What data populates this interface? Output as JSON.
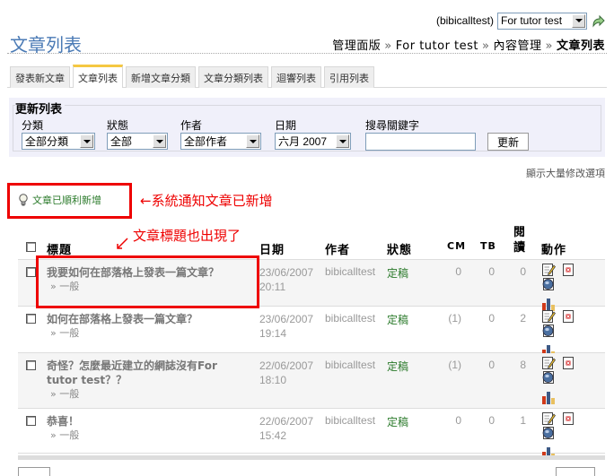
{
  "topbar": {
    "user": "(bibicalltest)",
    "blog_select": "For tutor test"
  },
  "page": {
    "title": "文章列表"
  },
  "breadcrumb": [
    "管理面版",
    "For tutor test",
    "內容管理",
    "文章列表"
  ],
  "breadcrumb_separator": "»",
  "tabs": [
    {
      "label": "發表新文章",
      "active": false
    },
    {
      "label": "文章列表",
      "active": true
    },
    {
      "label": "新增文章分類",
      "active": false
    },
    {
      "label": "文章分類列表",
      "active": false
    },
    {
      "label": "迴響列表",
      "active": false
    },
    {
      "label": "引用列表",
      "active": false
    }
  ],
  "filter": {
    "legend": "更新列表",
    "category": {
      "label": "分類",
      "value": "全部分類"
    },
    "status": {
      "label": "狀態",
      "value": "全部"
    },
    "author": {
      "label": "作者",
      "value": "全部作者"
    },
    "date": {
      "label": "日期",
      "value": "六月 2007"
    },
    "keyword": {
      "label": "搜尋關鍵字",
      "value": ""
    },
    "update_button": "更新"
  },
  "bulk_edit_link": "顯示大量修改選項",
  "notice": {
    "text": "文章已順利新增",
    "icon": "lightbulb-icon"
  },
  "annotations": {
    "notice": "←系統通知文章已新增",
    "title": "文章標題也出現了"
  },
  "table": {
    "headers": {
      "title": "標題",
      "date": "日期",
      "author": "作者",
      "status": "狀態",
      "cm": "CM",
      "tb": "TB",
      "reads": "閱讀",
      "reads_line1": "閱",
      "reads_line2": "讀",
      "actions": "動作"
    },
    "rows": [
      {
        "title": "我要如何在部落格上發表一篇文章？",
        "category": "» 一般",
        "date": "23/06/2007",
        "time": "20:11",
        "author": "bibicalltest",
        "status": "定稿",
        "cm": "0",
        "tb": "0",
        "reads": "0"
      },
      {
        "title": "如何在部落格上發表一篇文章？",
        "category": "» 一般",
        "date": "23/06/2007",
        "time": "19:14",
        "author": "bibicalltest",
        "status": "定稿",
        "cm": "(1)",
        "tb": "0",
        "reads": "2"
      },
      {
        "title": "奇怪？怎麼最近建立的網誌沒有For tutor test？？",
        "category": "» 一般",
        "date": "22/06/2007",
        "time": "18:10",
        "author": "bibicalltest",
        "status": "定稿",
        "cm": "(1)",
        "tb": "0",
        "reads": "8"
      },
      {
        "title": "恭喜！",
        "category": "» 一般",
        "date": "22/06/2007",
        "time": "15:42",
        "author": "bibicalltest",
        "status": "定稿",
        "cm": "0",
        "tb": "0",
        "reads": "1"
      }
    ]
  },
  "colors": {
    "accent_blue": "#4a7ab5",
    "status_green": "#2a7a2a",
    "annotation_red": "#ee0000",
    "active_tab": "#f5c842"
  }
}
